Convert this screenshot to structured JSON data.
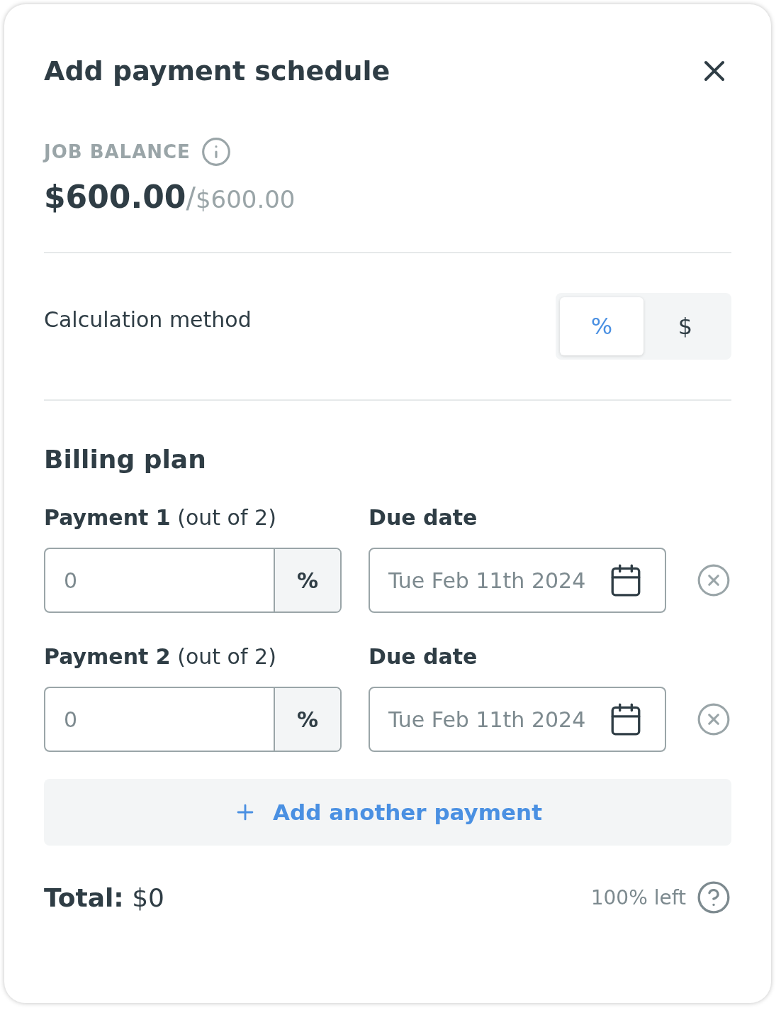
{
  "dialog": {
    "title": "Add payment schedule"
  },
  "balance": {
    "label": "JOB BALANCE",
    "amount": "$600.00",
    "separator": "/",
    "total": "$600.00"
  },
  "calculation": {
    "label": "Calculation method",
    "options": [
      {
        "label": "%",
        "selected": true
      },
      {
        "label": "$",
        "selected": false
      }
    ]
  },
  "billing": {
    "title": "Billing plan",
    "payments": [
      {
        "label": "**Payment 1** (out of 2)",
        "amount_placeholder": "0",
        "unit": "%",
        "date_label": "Due date",
        "date_placeholder": "Tue Feb 11th 2024"
      },
      {
        "label": "**Payment 2** (out of 2)",
        "amount_placeholder": "0",
        "unit": "%",
        "date_label": "Due date",
        "date_placeholder": "Tue Feb 11th 2024"
      }
    ],
    "add_button": "Add another payment"
  },
  "footer": {
    "total": "**Total:** $0",
    "remaining": "100% left"
  }
}
